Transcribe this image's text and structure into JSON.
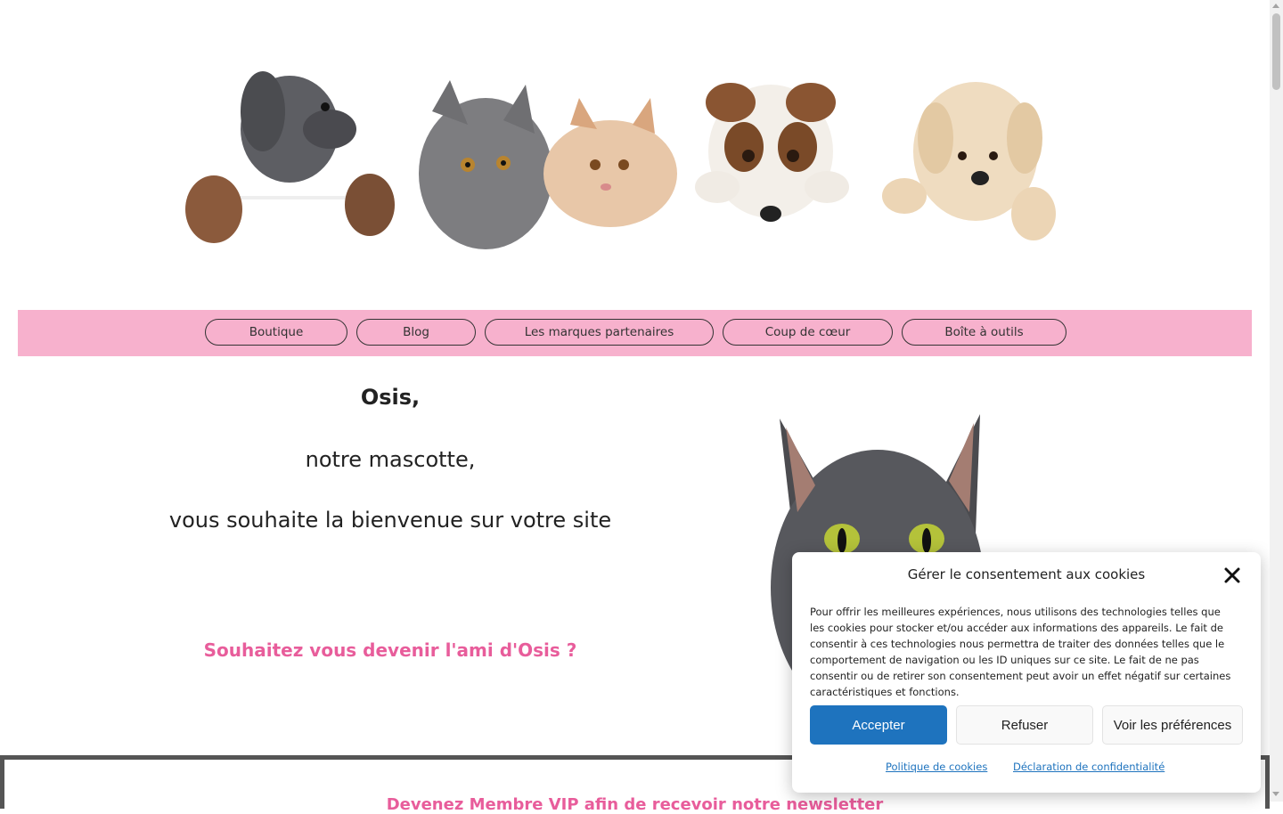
{
  "nav": {
    "items": [
      {
        "label": "Boutique"
      },
      {
        "label": "Blog"
      },
      {
        "label": "Les marques partenaires"
      },
      {
        "label": "Coup de cœur"
      },
      {
        "label": "Boîte à outils"
      }
    ]
  },
  "hero": {
    "name": "Osis,",
    "line1": "notre mascotte,",
    "line2": "vous souhaite la bienvenue sur votre site",
    "cta": "Souhaitez vous devenir l'ami d'Osis ?"
  },
  "newsletter": {
    "title": "Devenez Membre VIP afin de recevoir notre newsletter"
  },
  "cookie_modal": {
    "title": "Gérer le consentement aux cookies",
    "body": "Pour offrir les meilleures expériences, nous utilisons des technologies telles que les cookies pour stocker et/ou accéder aux informations des appareils. Le fait de consentir à ces technologies nous permettra de traiter des données telles que le comportement de navigation ou les ID uniques sur ce site. Le fait de ne pas consentir ou de retirer son consentement peut avoir un effet négatif sur certaines caractéristiques et fonctions.",
    "accept_label": "Accepter",
    "refuse_label": "Refuser",
    "prefs_label": "Voir les préférences",
    "cookie_policy_link": "Politique de cookies",
    "privacy_link": "Déclaration de confidentialité"
  },
  "colors": {
    "nav_bg": "#f7b1cd",
    "accent_pink": "#e85d9b",
    "primary_blue": "#1e73be"
  }
}
